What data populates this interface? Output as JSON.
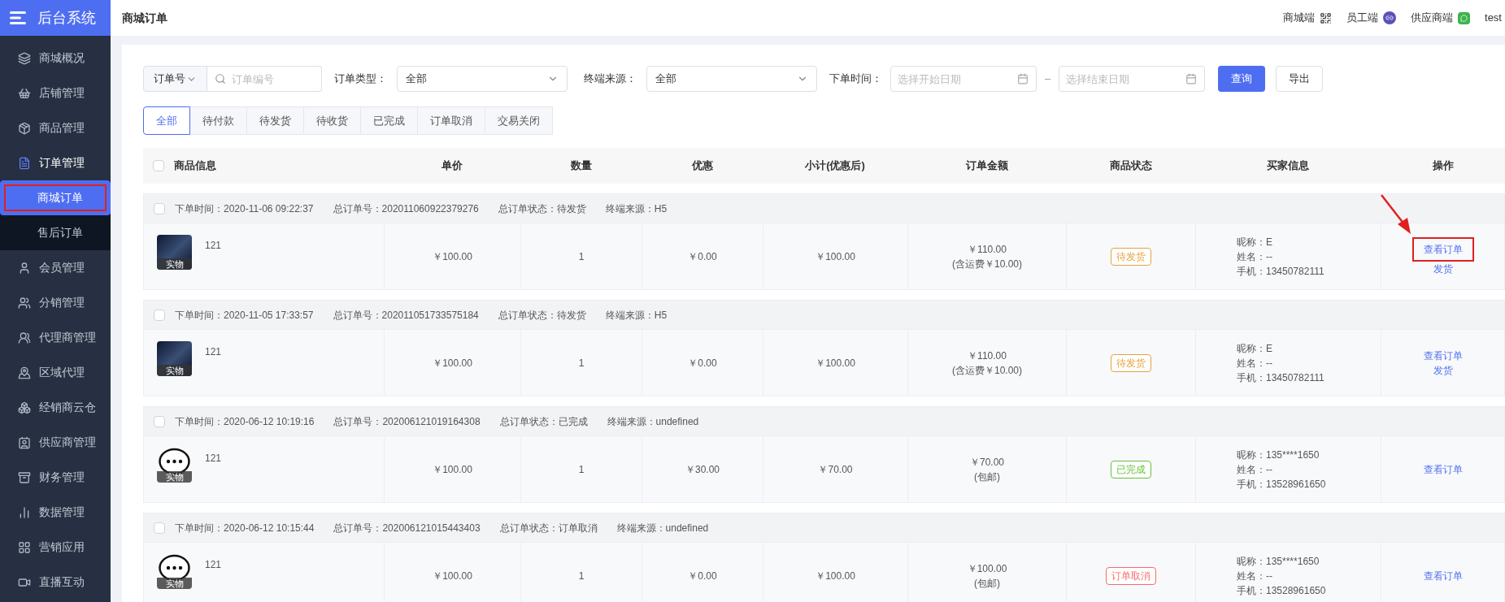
{
  "brand": {
    "title": "后台系统"
  },
  "sidebar": {
    "items": [
      {
        "label": "商城概况",
        "selected": false
      },
      {
        "label": "店铺管理",
        "selected": false
      },
      {
        "label": "商品管理",
        "selected": false
      },
      {
        "label": "订单管理",
        "selected": true,
        "expanded": true,
        "children": [
          {
            "label": "商城订单",
            "selected": true,
            "highlighted": true
          },
          {
            "label": "售后订单",
            "selected": false,
            "highlighted": false
          }
        ]
      },
      {
        "label": "会员管理",
        "selected": false
      },
      {
        "label": "分销管理",
        "selected": false
      },
      {
        "label": "代理商管理",
        "selected": false
      },
      {
        "label": "区域代理",
        "selected": false
      },
      {
        "label": "经销商云仓",
        "selected": false
      },
      {
        "label": "供应商管理",
        "selected": false
      },
      {
        "label": "财务管理",
        "selected": false
      },
      {
        "label": "数据管理",
        "selected": false
      },
      {
        "label": "营销应用",
        "selected": false
      },
      {
        "label": "直播互动",
        "selected": false
      }
    ]
  },
  "header": {
    "title": "商城订单",
    "links": [
      {
        "label": "商城端",
        "kind": "qr"
      },
      {
        "label": "员工端",
        "kind": "mini"
      },
      {
        "label": "供应商端",
        "kind": "wechat"
      }
    ],
    "user": "test"
  },
  "filters": {
    "search_type": "订单号",
    "search": {
      "placeholder": "订单编号"
    },
    "order_type": {
      "label": "订单类型：",
      "value": "全部"
    },
    "source": {
      "label": "终端来源：",
      "value": "全部"
    },
    "date": {
      "label": "下单时间：",
      "start_placeholder": "选择开始日期",
      "separator": "–",
      "end_placeholder": "选择结束日期"
    },
    "buttons": [
      {
        "label": "查询",
        "kind": "primary"
      },
      {
        "label": "导出",
        "kind": "default"
      }
    ]
  },
  "tabs": [
    {
      "label": "全部",
      "selected": true
    },
    {
      "label": "待付款",
      "selected": false
    },
    {
      "label": "待发货",
      "selected": false
    },
    {
      "label": "待收货",
      "selected": false
    },
    {
      "label": "已完成",
      "selected": false
    },
    {
      "label": "订单取消",
      "selected": false
    },
    {
      "label": "交易关闭",
      "selected": false
    }
  ],
  "table": {
    "checked": false,
    "columns": [
      "商品信息",
      "单价",
      "数量",
      "优惠",
      "小计(优惠后)",
      "订单金额",
      "商品状态",
      "买家信息",
      "操作"
    ],
    "orders": [
      {
        "checked": false,
        "meta": [
          "下单时间：2020-11-06 09:22:37",
          "总订单号：202011060922379276",
          "总订单状态：待发货",
          "终端来源：H5"
        ],
        "product": {
          "name": "121",
          "kind": "photo",
          "badge": "实物"
        },
        "unit_price": "￥100.00",
        "quantity": "1",
        "discount": "￥0.00",
        "subtotal": "￥100.00",
        "total": "￥110.00",
        "total_note": "(含运费￥10.00)",
        "status": {
          "label": "待发货",
          "color": "#e6a23c"
        },
        "buyer": [
          "昵称：E",
          "姓名：--",
          "手机：13450782111"
        ],
        "actions": [
          {
            "label": "查看订单",
            "highlighted": true
          },
          {
            "label": "发货",
            "highlighted": false
          }
        ]
      },
      {
        "checked": false,
        "meta": [
          "下单时间：2020-11-05 17:33:57",
          "总订单号：202011051733575184",
          "总订单状态：待发货",
          "终端来源：H5"
        ],
        "product": {
          "name": "121",
          "kind": "photo",
          "badge": "实物"
        },
        "unit_price": "￥100.00",
        "quantity": "1",
        "discount": "￥0.00",
        "subtotal": "￥100.00",
        "total": "￥110.00",
        "total_note": "(含运费￥10.00)",
        "status": {
          "label": "待发货",
          "color": "#e6a23c"
        },
        "buyer": [
          "昵称：E",
          "姓名：--",
          "手机：13450782111"
        ],
        "actions": [
          {
            "label": "查看订单",
            "highlighted": false
          },
          {
            "label": "发货",
            "highlighted": false
          }
        ]
      },
      {
        "checked": false,
        "meta": [
          "下单时间：2020-06-12 10:19:16",
          "总订单号：202006121019164308",
          "总订单状态：已完成",
          "终端来源：undefined"
        ],
        "product": {
          "name": "121",
          "kind": "placeholder",
          "badge": "实物"
        },
        "unit_price": "￥100.00",
        "quantity": "1",
        "discount": "￥30.00",
        "subtotal": "￥70.00",
        "total": "￥70.00",
        "total_note": "(包邮)",
        "status": {
          "label": "已完成",
          "color": "#67c23a"
        },
        "buyer": [
          "昵称：135****1650",
          "姓名：--",
          "手机：13528961650"
        ],
        "actions": [
          {
            "label": "查看订单",
            "highlighted": false
          }
        ]
      },
      {
        "checked": false,
        "meta": [
          "下单时间：2020-06-12 10:15:44",
          "总订单号：202006121015443403",
          "总订单状态：订单取消",
          "终端来源：undefined"
        ],
        "product": {
          "name": "121",
          "kind": "placeholder",
          "badge": "实物"
        },
        "unit_price": "￥100.00",
        "quantity": "1",
        "discount": "￥0.00",
        "subtotal": "￥100.00",
        "total": "￥100.00",
        "total_note": "(包邮)",
        "status": {
          "label": "订单取消",
          "color": "#f56c6c"
        },
        "buyer": [
          "昵称：135****1650",
          "姓名：--",
          "手机：13528961650"
        ],
        "actions": [
          {
            "label": "查看订单",
            "highlighted": false
          }
        ]
      }
    ]
  }
}
